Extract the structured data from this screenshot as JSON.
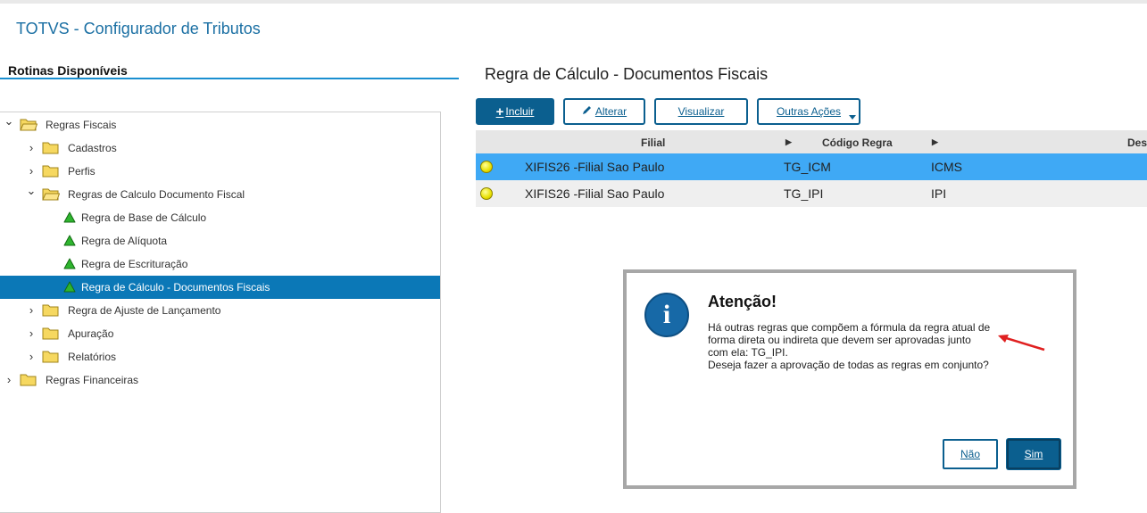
{
  "app": {
    "title": "TOTVS - Configurador de Tributos"
  },
  "sidebar": {
    "title": "Rotinas Disponíveis",
    "items": [
      {
        "label": "Regras Fiscais",
        "level": 0,
        "expanded": true,
        "icon": "folder-open-icon"
      },
      {
        "label": "Cadastros",
        "level": 1,
        "expanded": false,
        "icon": "folder-icon"
      },
      {
        "label": "Perfis",
        "level": 1,
        "expanded": false,
        "icon": "folder-icon"
      },
      {
        "label": "Regras de Calculo Documento Fiscal",
        "level": 1,
        "expanded": true,
        "icon": "folder-open-icon"
      },
      {
        "label": "Regra de Base de Cálculo",
        "level": 2,
        "icon": "green-triangle-icon"
      },
      {
        "label": "Regra de Alíquota",
        "level": 2,
        "icon": "green-triangle-icon"
      },
      {
        "label": "Regra de Escrituração",
        "level": 2,
        "icon": "green-triangle-icon"
      },
      {
        "label": "Regra de Cálculo - Documentos Fiscais",
        "level": 2,
        "icon": "green-triangle-icon",
        "selected": true
      },
      {
        "label": "Regra de Ajuste de Lançamento",
        "level": 1,
        "expanded": false,
        "icon": "folder-icon"
      },
      {
        "label": "Apuração",
        "level": 1,
        "expanded": false,
        "icon": "folder-icon"
      },
      {
        "label": "Relatórios",
        "level": 1,
        "expanded": false,
        "icon": "folder-icon"
      },
      {
        "label": "Regras Financeiras",
        "level": 0,
        "expanded": false,
        "icon": "folder-icon"
      }
    ]
  },
  "main": {
    "title": "Regra de Cálculo - Documentos Fiscais",
    "toolbar": {
      "incluir": "Incluir",
      "alterar": "Alterar",
      "visualizar": "Visualizar",
      "outras": "Outras Ações"
    },
    "grid": {
      "columns": [
        "Filial",
        "Código Regra",
        "Desc"
      ],
      "rows": [
        {
          "filial": "XIFIS26 -Filial Sao Paulo",
          "codigo": "TG_ICM",
          "descricao": "ICMS",
          "selected": true
        },
        {
          "filial": "XIFIS26 -Filial Sao Paulo",
          "codigo": "TG_IPI",
          "descricao": "IPI",
          "selected": false
        }
      ]
    }
  },
  "dialog": {
    "title": "Atenção!",
    "message": "Há outras regras que compõem a fórmula da regra atual de forma direta ou indireta que devem ser aprovadas junto com ela: TG_IPI.",
    "question": "Deseja fazer a aprovação de todas as regras em conjunto?",
    "no_label": "Não",
    "yes_label": "Sim"
  },
  "colors": {
    "brand": "#1a6fa3",
    "selected_row": "#3fa9f5",
    "tree_selected": "#0b78b7",
    "button_primary": "#0b5f8f",
    "status_dot": "#e8e000",
    "annotation_arrow": "#e02020"
  }
}
